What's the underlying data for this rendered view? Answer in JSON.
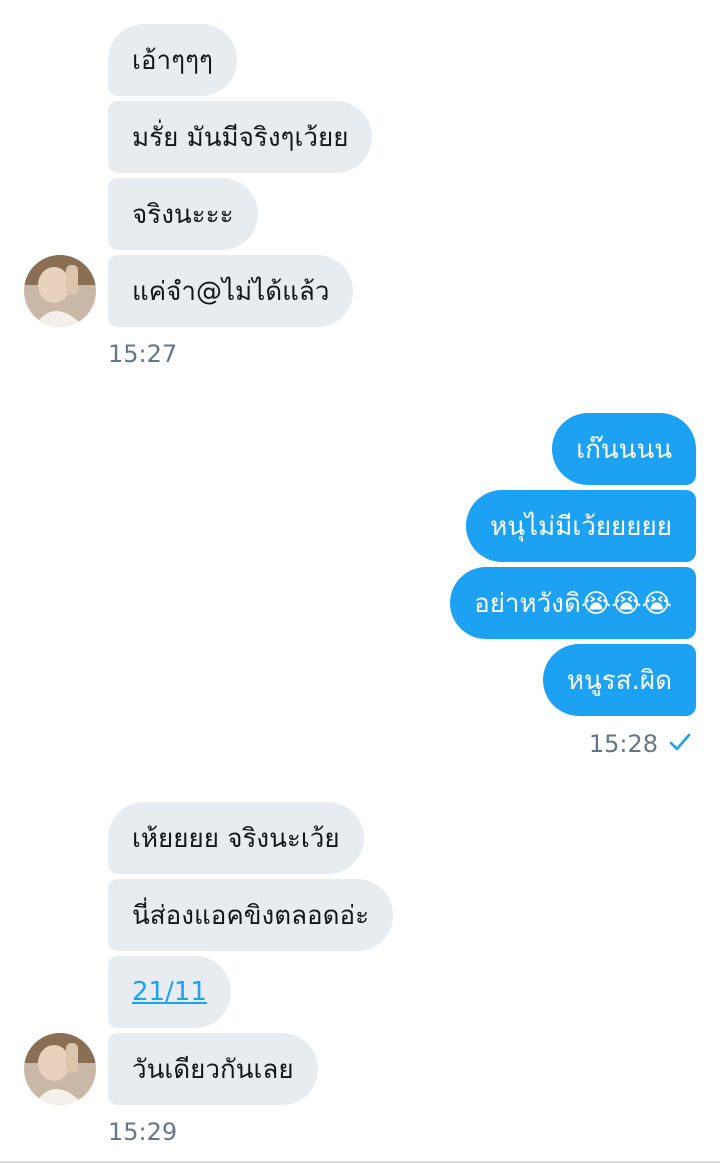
{
  "conversation": {
    "group1": {
      "messages": [
        "เอ้าๆๆๆ",
        "มรั่ย มันมีจริงๆเว้ยย",
        "จริงนะะะ",
        "แค่จำ@ไม่ได้แล้ว"
      ],
      "time": "15:27"
    },
    "group2": {
      "messages": [
        "เก๊นนนน",
        "หนุไม่มีเว้ยยยยย",
        "อย่าหวังดิ😭😭😭",
        "หนูรส.ผิด"
      ],
      "time": "15:28",
      "read_icon": "checkmark-icon"
    },
    "group3": {
      "messages": [
        "เห้ยยยย จริงนะเว้ย",
        "นี่ส่องแอคขิงตลอดอ่ะ",
        "21/11",
        "วันเดียวกันเลย"
      ],
      "time": "15:29"
    }
  },
  "colors": {
    "incoming_bubble": "#e6ecf0",
    "outgoing_bubble": "#1da1f2",
    "timestamp": "#657786",
    "link": "#1da1f2"
  }
}
